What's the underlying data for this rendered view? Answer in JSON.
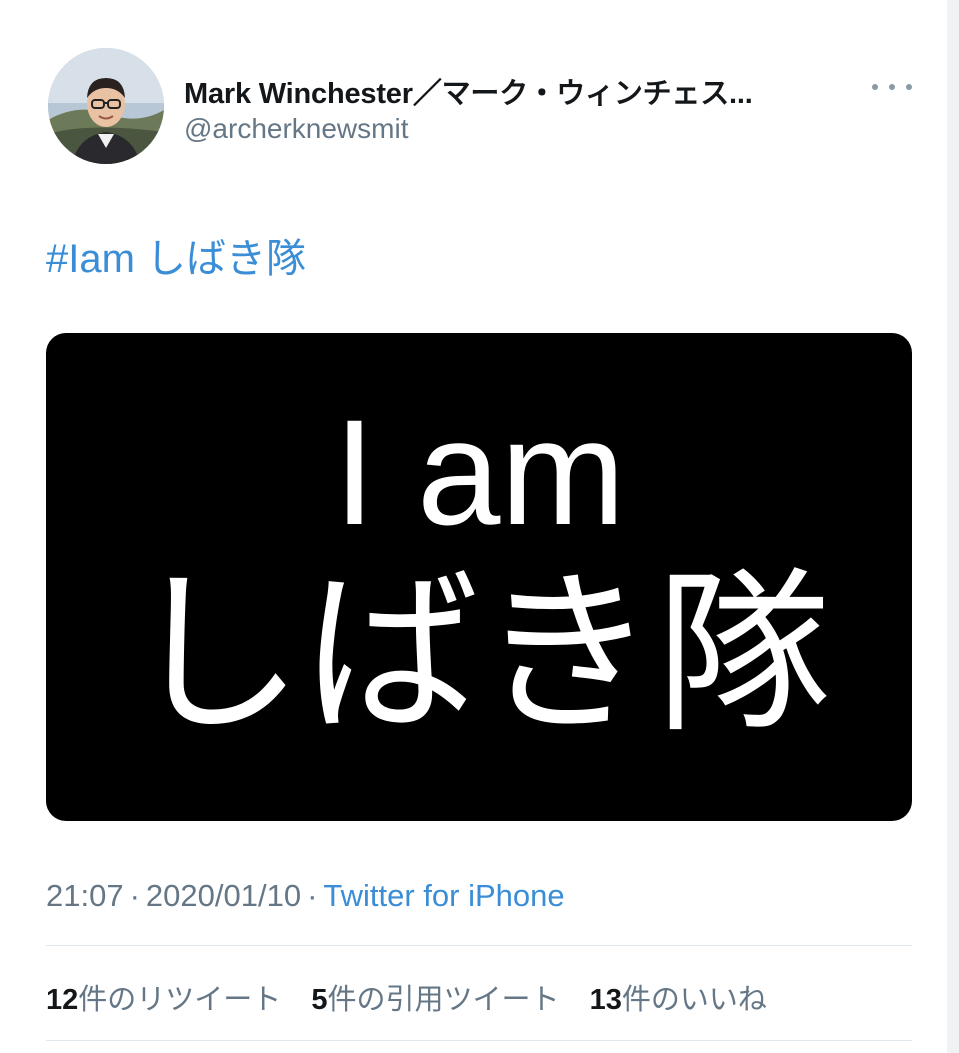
{
  "tweet": {
    "author": {
      "display_name": "Mark Winchester／マーク・ウィンチェス...",
      "handle": "@archerknewsmit"
    },
    "hashtag": "#Iam しばき隊",
    "image": {
      "line1": "I am",
      "line2": "しばき隊"
    },
    "meta": {
      "time": "21:07",
      "date": "2020/01/10",
      "separator": "·",
      "source": "Twitter for iPhone"
    },
    "stats": [
      {
        "count": "12",
        "label": "件のリツイート"
      },
      {
        "count": "5",
        "label": "件の引用ツイート"
      },
      {
        "count": "13",
        "label": "件のいいね"
      }
    ]
  },
  "colors": {
    "link": "#3b8ed6",
    "secondary_text": "#657786",
    "primary_text": "#14171a",
    "media_background": "#000000"
  },
  "icons": {
    "more": "more-options-icon"
  }
}
